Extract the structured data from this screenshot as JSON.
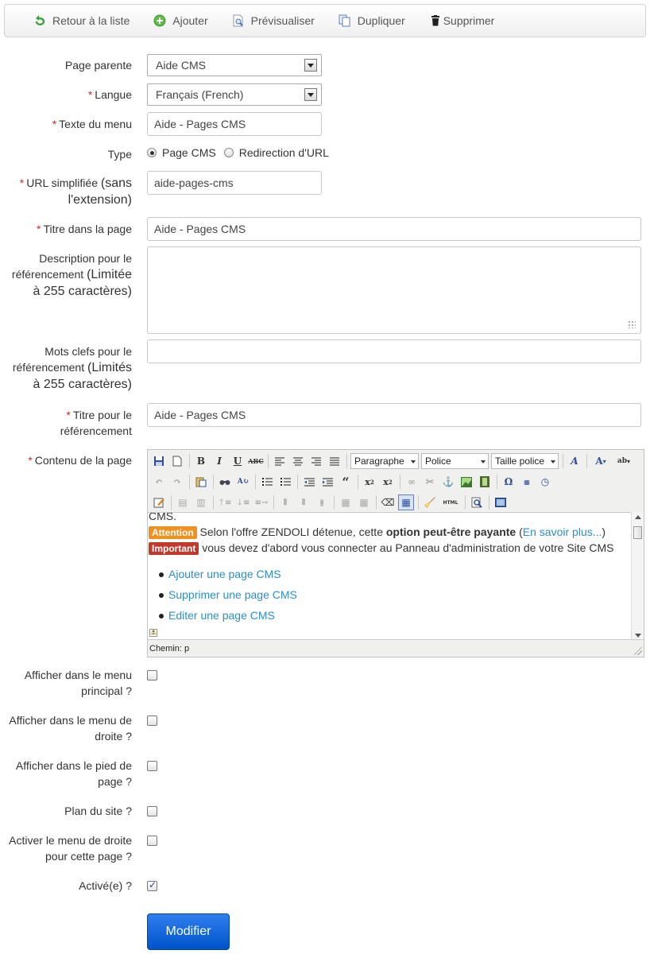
{
  "toolbar": {
    "back": "Retour à la liste",
    "add": "Ajouter",
    "preview": "Prévisualiser",
    "duplicate": "Dupliquer",
    "delete": "Supprimer"
  },
  "form": {
    "parent": {
      "label": "Page parente",
      "value": "Aide CMS"
    },
    "language": {
      "required": "*",
      "label": "Langue",
      "value": "Français (French)"
    },
    "menu_text": {
      "required": "*",
      "label": "Texte du menu",
      "value": "Aide - Pages CMS"
    },
    "type": {
      "label": "Type",
      "option_cms": "Page CMS",
      "option_redirect": "Redirection d'URL",
      "selected": "Page CMS"
    },
    "url": {
      "required": "*",
      "label": "URL simplifiée",
      "note_l1": "(sans",
      "note_l2": "l'extension)",
      "value": "aide-pages-cms"
    },
    "page_title": {
      "required": "*",
      "label": "Titre dans la page",
      "value": "Aide - Pages CMS"
    },
    "description": {
      "label_l1": "Description pour le",
      "label_l2": "référencement",
      "note_l1": "(Limitée",
      "note_l2": "à 255 caractères)",
      "value": ""
    },
    "keywords": {
      "label_l1": "Mots clefs pour le",
      "label_l2": "référencement",
      "note_l1": "(Limités",
      "note_l2": "à 255 caractères)",
      "value": ""
    },
    "seo_title": {
      "required": "*",
      "label_l1": "Titre pour le",
      "label_l2": "référencement",
      "value": "Aide - Pages CMS"
    },
    "content": {
      "required": "*",
      "label": "Contenu de la page"
    }
  },
  "editor": {
    "format_select": "Paragraphe",
    "font_select": "Police",
    "size_select": "Taille police",
    "content": {
      "line0": "CMS.",
      "badge_attention": "Attention",
      "line1_a": " Selon l'offre ZENDOLI détenue, cette ",
      "line1_bold": "option peut-être payante",
      "line1_b": " (",
      "line1_link": "En savoir plus...",
      "line1_c": ")",
      "badge_important": "Important",
      "line2": " vous devez d'abord vous connecter au Panneau d'administration de votre Site CMS",
      "links": [
        "Ajouter une page CMS",
        "Supprimer une page CMS",
        "Editer une page CMS"
      ]
    },
    "status_path": "Chemin: p"
  },
  "options": {
    "main_menu": {
      "label_l1": "Afficher dans le menu",
      "label_l2": "principal ?",
      "checked": false
    },
    "right_menu": {
      "label_l1": "Afficher dans le menu de",
      "label_l2": "droite ?",
      "checked": false
    },
    "footer": {
      "label_l1": "Afficher dans le pied de",
      "label_l2": "page ?",
      "checked": false
    },
    "sitemap": {
      "label_l1": "Plan du site ?",
      "checked": false
    },
    "right_menu_page": {
      "label_l1": "Activer le menu de droite",
      "label_l2": "pour cette page ?",
      "checked": false
    },
    "active": {
      "label_l1": "Activé(e) ?",
      "checked": true
    }
  },
  "submit_label": "Modifier",
  "colors": {
    "required": "#c83025",
    "link": "#2a8fc7",
    "button": "#0a5fdb",
    "attention": "#f0901f",
    "important": "#c0392b"
  }
}
